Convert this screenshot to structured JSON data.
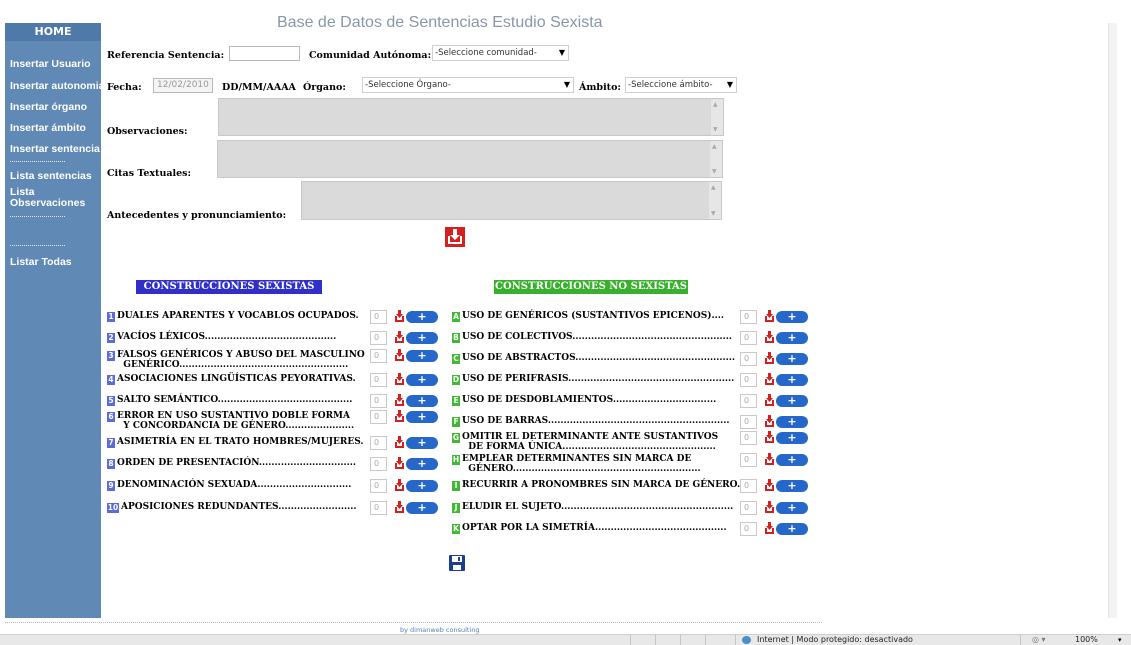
{
  "title": "Base de Datos de Sentencias Estudio Sexista",
  "sidebar": {
    "home": "HOME",
    "items": [
      "Insertar Usuario",
      "Insertar autonomia",
      "Insertar órgano",
      "Insertar ámbito",
      "Insertar sentencia",
      "Lista sentencias",
      "Lista",
      "Observaciones",
      "Listar Todas"
    ]
  },
  "form": {
    "ref_label": "Referencia Sentencia:",
    "ref_value": "",
    "comunidad_label": "Comunidad Autónoma:",
    "comunidad_value": "-Seleccione comunidad-",
    "fecha_label": "Fecha:",
    "fecha_value": "12/02/2010",
    "fecha_format": "DD/MM/AAAA",
    "organo_label": "Órgano:",
    "organo_value": "-Seleccione Órgano-",
    "ambito_label": "Ámbito:",
    "ambito_value": "-Seleccione ámbito-",
    "observaciones_label": "Observaciones:",
    "citas_label": "Citas Textuales:",
    "antecedentes_label": "Antecedentes y pronunciamiento:"
  },
  "sexistas": {
    "header": "CONSTRUCCIONES SEXISTAS",
    "rows": [
      {
        "n": "1",
        "text": "DUALES APARENTES Y VOCABLOS OCUPADOS.",
        "count": "0"
      },
      {
        "n": "2",
        "text": "VACÍOS LÉXICOS..........................................",
        "count": "0"
      },
      {
        "n": "3",
        "text": "FALSOS GENÉRICOS Y ABUSO DEL MASCULINO\n  GENÉRICO......................................................",
        "count": "0"
      },
      {
        "n": "4",
        "text": "ASOCIACIONES LINGÜÍSTICAS PEYORATIVAS.",
        "count": "0"
      },
      {
        "n": "5",
        "text": "SALTO SEMÁNTICO...........................................",
        "count": "0"
      },
      {
        "n": "6",
        "text": "ERROR EN USO SUSTANTIVO DOBLE FORMA\n  Y CONCORDANCIA DE GÉNERO......................",
        "count": "0"
      },
      {
        "n": "7",
        "text": "ASIMETRÍA EN EL TRATO HOMBRES/MUJERES.",
        "count": "0"
      },
      {
        "n": "8",
        "text": "ORDEN DE PRESENTACIÓN...............................",
        "count": "0"
      },
      {
        "n": "9",
        "text": "DENOMINACIÓN SEXUADA..............................",
        "count": "0"
      },
      {
        "n": "10",
        "text": "APOSICIONES REDUNDANTES.........................",
        "count": "0"
      }
    ]
  },
  "no_sexistas": {
    "header": "CONSTRUCCIONES NO SEXISTAS",
    "rows": [
      {
        "n": "A",
        "text": "USO DE GENÉRICOS (SUSTANTIVOS EPICENOS)....",
        "count": "0"
      },
      {
        "n": "B",
        "text": "USO DE COLECTIVOS...................................................",
        "count": "0"
      },
      {
        "n": "C",
        "text": "USO DE ABSTRACTOS...................................................",
        "count": "0"
      },
      {
        "n": "D",
        "text": "USO DE PERIFRASIS.....................................................",
        "count": "0"
      },
      {
        "n": "E",
        "text": "USO DE DESDOBLAMIENTOS.................................",
        "count": "0"
      },
      {
        "n": "F",
        "text": "USO DE BARRAS..........................................................",
        "count": "0"
      },
      {
        "n": "G",
        "text": "OMITIR EL DETERMINANTE ANTE SUSTANTIVOS\n  DE FORMA ÚNICA.................................................",
        "count": "0"
      },
      {
        "n": "H",
        "text": "EMPLEAR DETERMINANTES SIN MARCA DE\n  GÉNERO............................................................",
        "count": "0"
      },
      {
        "n": "I",
        "text": "RECURRIR A PRONOMBRES SIN MARCA DE GÉNERO.",
        "count": "0"
      },
      {
        "n": "J",
        "text": "ELUDIR EL SUJETO.......................................................",
        "count": "0"
      },
      {
        "n": "K",
        "text": "OPTAR POR LA SIMETRÍA..........................................",
        "count": "0"
      }
    ]
  },
  "add_label": "+",
  "footer": "by dimanweb consulting",
  "statusbar": {
    "zone": "Internet | Modo protegido: desactivado",
    "zoom": "100%"
  },
  "colors": {
    "sidebar": "#6189b5",
    "header_sexistas": "#3030c8",
    "header_no_sexistas": "#38b02e",
    "add_button": "#2568c9",
    "download_icon": "#d42020"
  }
}
